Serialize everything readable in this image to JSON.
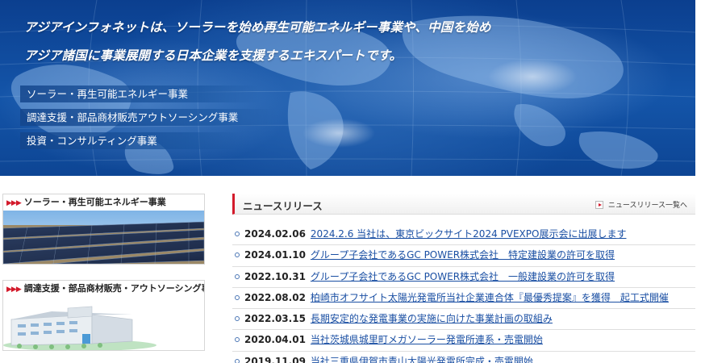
{
  "hero": {
    "tagline_line1": "アジアインフォネットは、ソーラーを始め再生可能エネルギー事業や、中国を始め",
    "tagline_line2": "アジア諸国に事業展開する日本企業を支援するエキスパートです。",
    "services": [
      "ソーラー・再生可能エネルギー事業",
      "調達支援・部品商材販売アウトソーシング事業",
      "投資・コンサルティング事業"
    ]
  },
  "business_cards": [
    {
      "arrows": "▶▶▶",
      "title": "ソーラー・再生可能エネルギー事業",
      "image": "solar-panels-image"
    },
    {
      "arrows": "▶▶▶",
      "title": "調達支援・部品商材販売・アウトソーシング事業",
      "image": "factory-building-image"
    }
  ],
  "news": {
    "title": "ニュースリリース",
    "more_label": "ニュースリリース一覧へ",
    "items": [
      {
        "date": "2024.02.06",
        "text": "2024.2.6 当社は、東京ビックサイト2024 PVEXPO展示会に出展します"
      },
      {
        "date": "2024.01.10",
        "text": "グループ子会社であるGC POWER株式会社　特定建設業の許可を取得"
      },
      {
        "date": "2022.10.31",
        "text": "グループ子会社であるGC POWER株式会社　一般建設業の許可を取得"
      },
      {
        "date": "2022.08.02",
        "text": "柏崎市オフサイト太陽光発電所当社企業連合体『最優秀提案』を獲得　起工式開催"
      },
      {
        "date": "2022.03.15",
        "text": "長期安定的な発電事業の実施に向けた事業計画の取組み"
      },
      {
        "date": "2020.04.01",
        "text": "当社茨城県城里町メガソーラー発電所連系・売電開始"
      },
      {
        "date": "2019.11.09",
        "text": "当社三重県伊賀市青山太陽光発電所完成・売電開始"
      }
    ]
  },
  "colors": {
    "accent_red": "#d31a2b",
    "link_blue": "#1a4fa3",
    "hero_blue": "#1455a9"
  }
}
